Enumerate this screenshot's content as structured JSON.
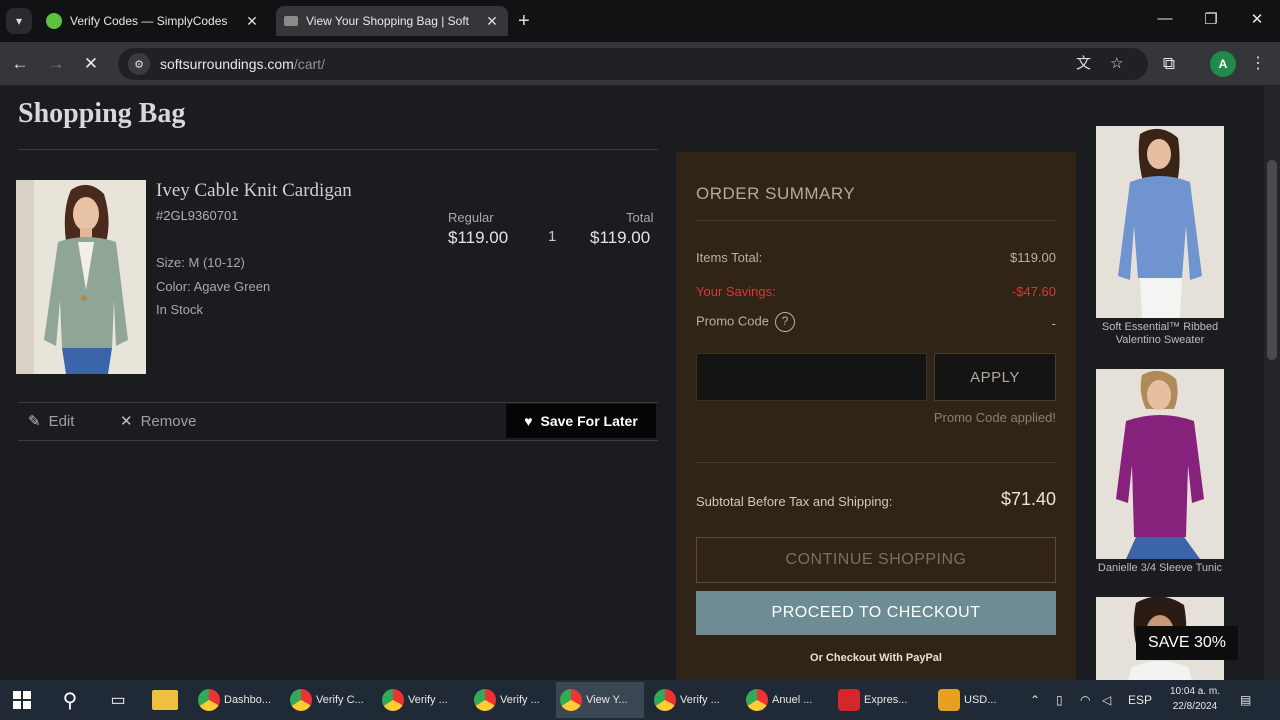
{
  "browser": {
    "tabs": [
      {
        "title": "Verify Codes — SimplyCodes",
        "close": "✕"
      },
      {
        "title": "View Your Shopping Bag | Soft",
        "close": "✕"
      }
    ],
    "new_tab": "+",
    "url_host": "softsurroundings.com",
    "url_path": "/cart/",
    "window_controls": {
      "minimize": "—",
      "restore": "❐",
      "close": "✕"
    },
    "profile_initial": "A"
  },
  "page": {
    "title": "Shopping Bag",
    "item": {
      "name": "Ivey Cable Knit Cardigan",
      "sku": "#2GL9360701",
      "size": "Size: M (10-12)",
      "color": "Color: Agave Green",
      "stock": "In Stock",
      "regular_label": "Regular",
      "regular_price": "$119.00",
      "quantity": "1",
      "total_label": "Total",
      "total_price": "$119.00"
    },
    "actions": {
      "edit": "Edit",
      "remove": "Remove",
      "save_for_later": "Save For Later"
    }
  },
  "summary": {
    "title": "ORDER SUMMARY",
    "items_total_label": "Items Total:",
    "items_total_value": "$119.00",
    "savings_label": "Your Savings:",
    "savings_value": "-$47.60",
    "promo_label": "Promo Code",
    "promo_value": "-",
    "promo_placeholder": "",
    "apply_label": "APPLY",
    "promo_applied": "Promo Code applied!",
    "subtotal_label": "Subtotal Before Tax and Shipping:",
    "subtotal_value": "$71.40",
    "continue_label": "CONTINUE SHOPPING",
    "checkout_label": "PROCEED TO CHECKOUT",
    "paypal_label": "Or Checkout With PayPal",
    "colors": {
      "panel": "#2f2416",
      "savings": "#e03434",
      "checkout": "#6e8c93"
    }
  },
  "recommendations": [
    {
      "label": "Soft Essential™ Ribbed Valentino Sweater"
    },
    {
      "label": "Danielle 3/4 Sleeve Tunic"
    },
    {
      "label": ""
    }
  ],
  "save_badge": "SAVE 30%",
  "taskbar": {
    "apps": [
      {
        "label": "Dashbo..."
      },
      {
        "label": "Verify C..."
      },
      {
        "label": "Verify ..."
      },
      {
        "label": "Verify ..."
      },
      {
        "label": "View Y..."
      },
      {
        "label": "Verify ..."
      },
      {
        "label": "Anuel ..."
      },
      {
        "label": "Expres..."
      },
      {
        "label": "USD..."
      }
    ],
    "language": "ESP",
    "time": "10:04 a. m.",
    "date": "22/8/2024"
  }
}
